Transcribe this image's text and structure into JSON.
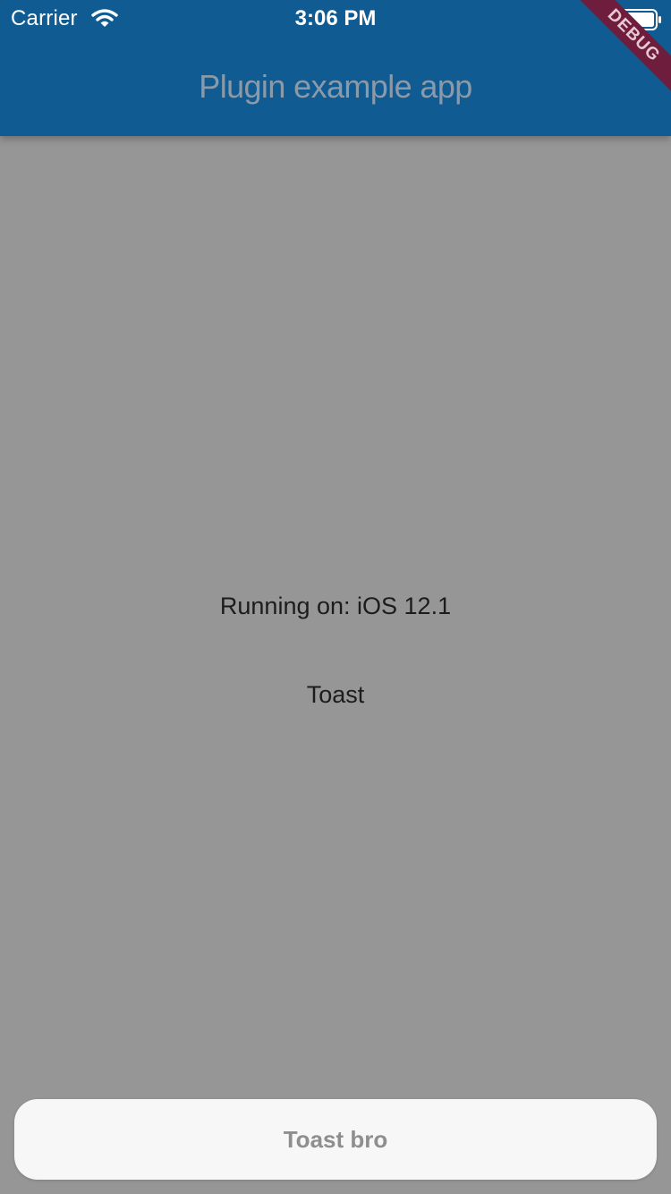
{
  "status_bar": {
    "carrier": "Carrier",
    "time": "3:06 PM",
    "wifi_icon": "wifi-icon",
    "battery_icon": "battery-icon"
  },
  "app_bar": {
    "title": "Plugin example app",
    "background_color": "#115b93"
  },
  "debug_banner": {
    "label": "DEBUG",
    "color": "#6e1e3c"
  },
  "main": {
    "running_text": "Running on: iOS 12.1",
    "toast_button_label": "Toast",
    "background_color": "#969696"
  },
  "toast": {
    "message": "Toast bro"
  }
}
